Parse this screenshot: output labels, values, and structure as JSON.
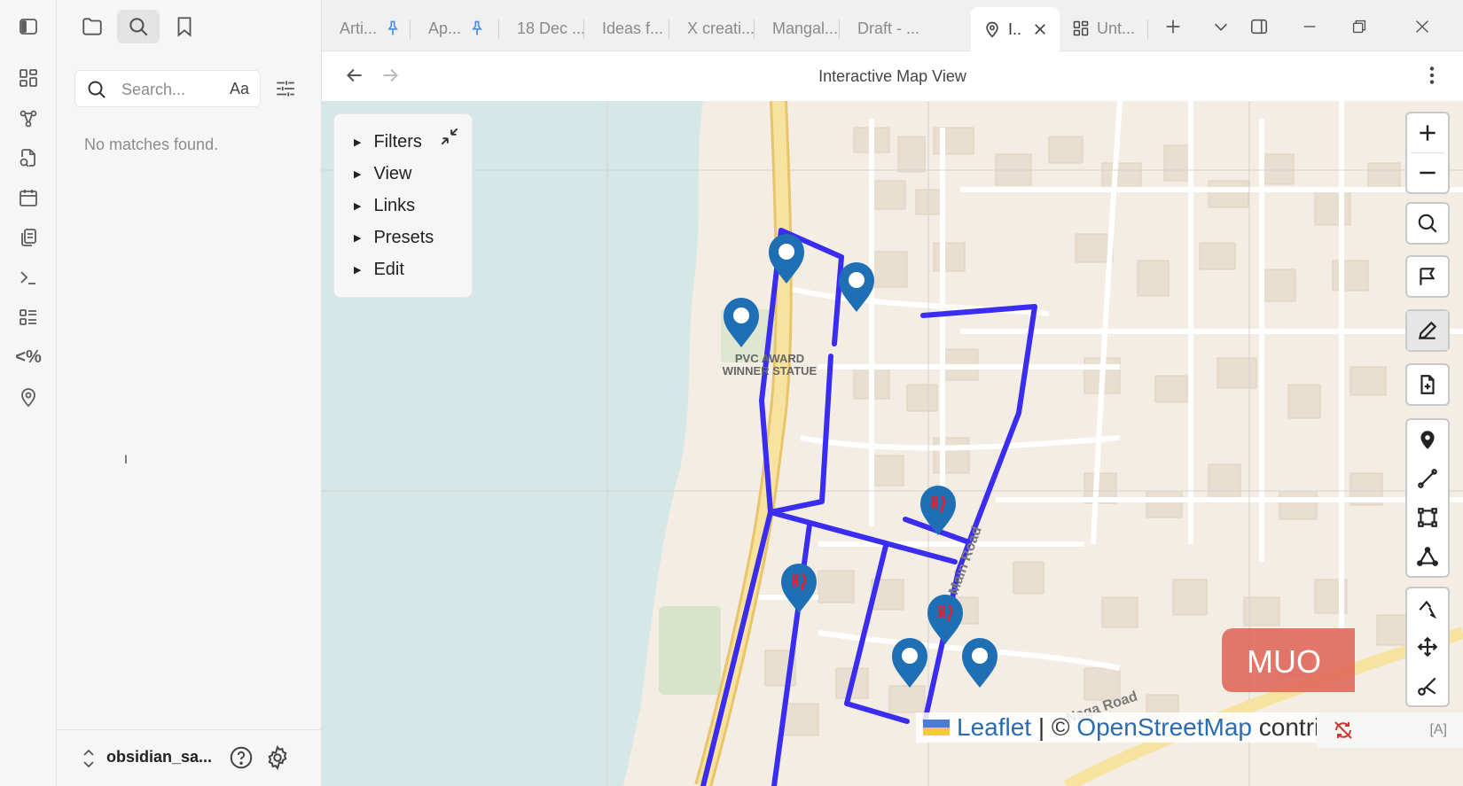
{
  "ribbon": {
    "items": [
      {
        "name": "sidebar-toggle-icon"
      },
      {
        "name": "dashboard-icon"
      },
      {
        "name": "graph-icon"
      },
      {
        "name": "new-note-icon"
      },
      {
        "name": "calendar-icon"
      },
      {
        "name": "copy-icon"
      },
      {
        "name": "terminal-icon"
      },
      {
        "name": "list-icon"
      },
      {
        "name": "templater-icon",
        "text": "<%"
      },
      {
        "name": "map-pin-icon"
      }
    ]
  },
  "sidebar": {
    "tabs": [
      {
        "name": "files-tab",
        "icon": "folder-icon"
      },
      {
        "name": "search-tab",
        "icon": "search-icon",
        "active": true
      },
      {
        "name": "bookmarks-tab",
        "icon": "bookmark-icon"
      }
    ],
    "search": {
      "placeholder": "Search...",
      "match_case_label": "Aa"
    },
    "empty_message": "No matches found.",
    "vault_name": "obsidian_sa..."
  },
  "tabs": [
    {
      "label": "Arti...",
      "pinned": true
    },
    {
      "label": "Ap...",
      "pinned": true
    },
    {
      "label": "18 Dec ..."
    },
    {
      "label": "Ideas f..."
    },
    {
      "label": "X creati..."
    },
    {
      "label": "Mangal..."
    },
    {
      "label": "Draft - ..."
    },
    {
      "label": "I..",
      "active": true,
      "icon": "map-pin-icon"
    },
    {
      "label": "Unt...",
      "icon": "dashboard-icon"
    }
  ],
  "view": {
    "title": "Interactive Map View"
  },
  "map": {
    "panel_items": [
      "Filters",
      "View",
      "Links",
      "Presets",
      "Edit"
    ],
    "poi_label_lines": [
      "PVC AWARD",
      "WINNER STATUE"
    ],
    "road_labels": [
      "Main Road",
      "Naga Road"
    ],
    "attribution": {
      "prefix": "Leaflet",
      "separator": " | © ",
      "osm": "OpenStreetMap",
      "suffix": " contri"
    },
    "watermark": "MUO",
    "plugin_badge": "[A]",
    "route_color": "#3a2cf0",
    "water_color": "#d6e7e8",
    "road_color": "#f7e3a0",
    "marker_color": "#1f6fb5"
  }
}
